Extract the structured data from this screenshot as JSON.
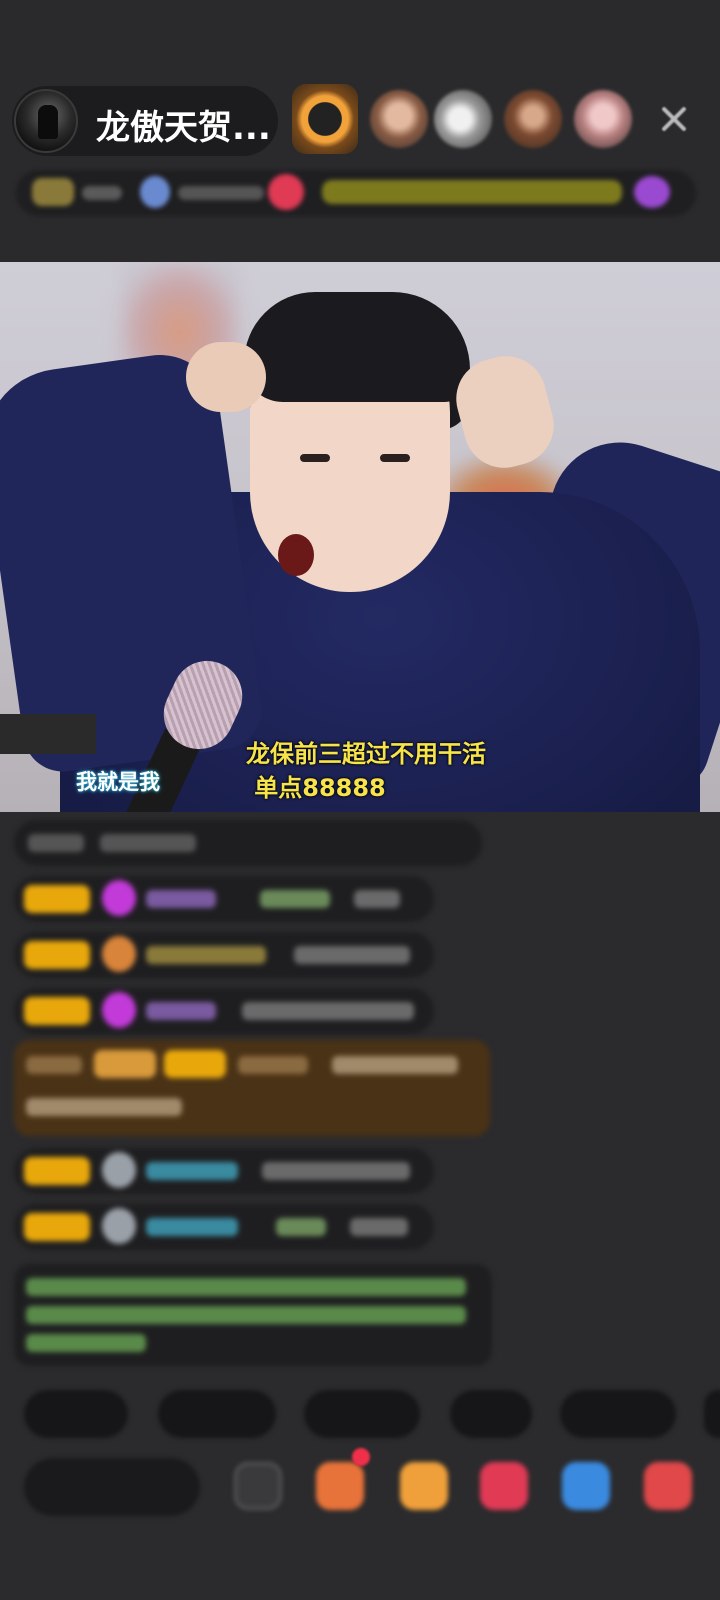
{
  "header": {
    "anchor_name": "龙傲天贺..."
  },
  "video": {
    "caption_line1": "龙保前三超过不用干活",
    "caption_line2": "单点88888",
    "corner_tag": "我就是我"
  },
  "colors": {
    "background": "#2b2b2d",
    "caption_yellow": "#f6e44a",
    "badge_gold": "#e8a80c",
    "gift_row": "#4a3216"
  },
  "icons": [
    "close-icon",
    "emoji-icon",
    "gift-icon",
    "red-packet-icon",
    "shop-icon",
    "game-icon",
    "more-icon"
  ]
}
